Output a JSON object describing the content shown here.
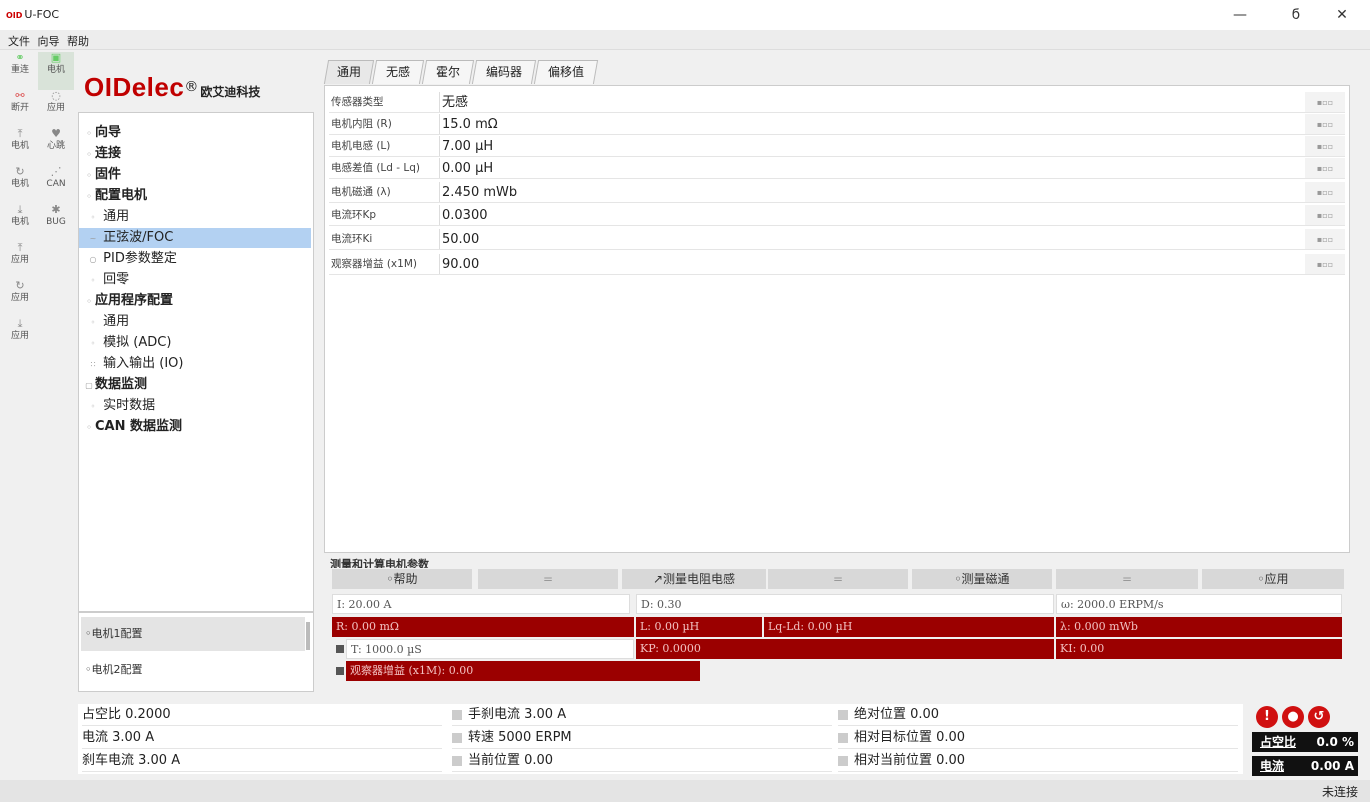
{
  "window": {
    "logo": "OID",
    "title": "U-FOC",
    "min": "—",
    "max": "ϭ",
    "close": "✕"
  },
  "menu": [
    "文件",
    "向导",
    "帮助"
  ],
  "toolbar": [
    {
      "label": "重连",
      "icon": "link-icon"
    },
    {
      "label": "电机",
      "icon": "motor-icon"
    },
    {
      "label": "断开",
      "icon": "unlink-icon"
    },
    {
      "label": "应用",
      "icon": "apply-icon"
    },
    {
      "label": "电机",
      "icon": "upload-icon"
    },
    {
      "label": "心跳",
      "icon": "heart-icon"
    },
    {
      "label": "电机",
      "icon": "refresh-icon"
    },
    {
      "label": "CAN",
      "icon": "can-icon"
    },
    {
      "label": "电机",
      "icon": "download-icon"
    },
    {
      "label": "BUG",
      "icon": "bug-icon"
    },
    {
      "label": "应用",
      "icon": "upload-icon"
    },
    {
      "label": "应用",
      "icon": "refresh-icon"
    },
    {
      "label": "应用",
      "icon": "download-icon"
    }
  ],
  "brand": {
    "name1": "OIDelec",
    "reg": "®",
    "cn": "欧艾迪科技"
  },
  "nav": [
    {
      "label": "向导",
      "bold": true
    },
    {
      "label": "连接",
      "bold": true
    },
    {
      "label": "固件",
      "bold": true
    },
    {
      "label": "配置电机",
      "bold": true
    },
    {
      "label": "通用",
      "bold": false
    },
    {
      "label": "正弦波/FOC",
      "bold": false,
      "selected": true
    },
    {
      "label": "PID参数整定",
      "bold": false
    },
    {
      "label": "回零",
      "bold": false
    },
    {
      "label": "应用程序配置",
      "bold": true
    },
    {
      "label": "通用",
      "bold": false
    },
    {
      "label": "模拟 (ADC)",
      "bold": false
    },
    {
      "label": "输入输出 (IO)",
      "bold": false
    },
    {
      "label": "数据监测",
      "bold": true
    },
    {
      "label": "实时数据",
      "bold": false
    },
    {
      "label": "CAN 数据监测",
      "bold": true
    }
  ],
  "motors": [
    "电机1配置",
    "电机2配置"
  ],
  "tabs": [
    "通用",
    "无感",
    "霍尔",
    "编码器",
    "偏移值"
  ],
  "params": [
    {
      "label": "传感器类型",
      "value": "无感"
    },
    {
      "label": "电机内阻 (R)",
      "value": "15.0 mΩ"
    },
    {
      "label": "电机电感 (L)",
      "value": "7.00 µH"
    },
    {
      "label": "电感差值 (Ld - Lq)",
      "value": "0.00 µH"
    },
    {
      "label": "电机磁通 (λ)",
      "value": "2.450 mWb"
    },
    {
      "label": "电流环Kp",
      "value": "0.0300"
    },
    {
      "label": "电流环Ki",
      "value": "50.00"
    },
    {
      "label": "观察器增益 (x1M)",
      "value": "90.00"
    }
  ],
  "measure": {
    "title": "测量和计算电机参数",
    "btn_help": "帮助",
    "btn_rl": "测量电阻电感",
    "btn_flux": "测量磁通",
    "btn_apply": "应用",
    "sep": "=",
    "i": "I: 20.00 A",
    "d": "D: 0.30",
    "w": "ω: 2000.0 ERPM/s",
    "r": "R: 0.00 mΩ",
    "l": "L: 0.00 µH",
    "lqld": "Lq-Ld: 0.00 µH",
    "lambda": "λ: 0.000 mWb",
    "t": "T: 1000.0 µS",
    "kp": "KP: 0.0000",
    "ki": "KI: 0.00",
    "obs": "观察器增益 (x1M): 0.00"
  },
  "status": {
    "duty": "占空比 0.2000",
    "current": "电流 3.00 A",
    "brake": "刹车电流 3.00 A",
    "handbrake": "手刹电流 3.00 A",
    "speed": "转速 5000 ERPM",
    "curpos": "当前位置 0.00",
    "abspos": "绝对位置 0.00",
    "reltarget": "相对目标位置 0.00",
    "relcur": "相对当前位置 0.00"
  },
  "displays": {
    "duty_label": "占空比",
    "duty_value": "0.0 %",
    "cur_label": "电流",
    "cur_value": "0.00 A"
  },
  "statusbar": "未连接",
  "colors": {
    "brand_red": "#c00000",
    "dark_red": "#9b0000",
    "selection": "#b3d1f2"
  }
}
